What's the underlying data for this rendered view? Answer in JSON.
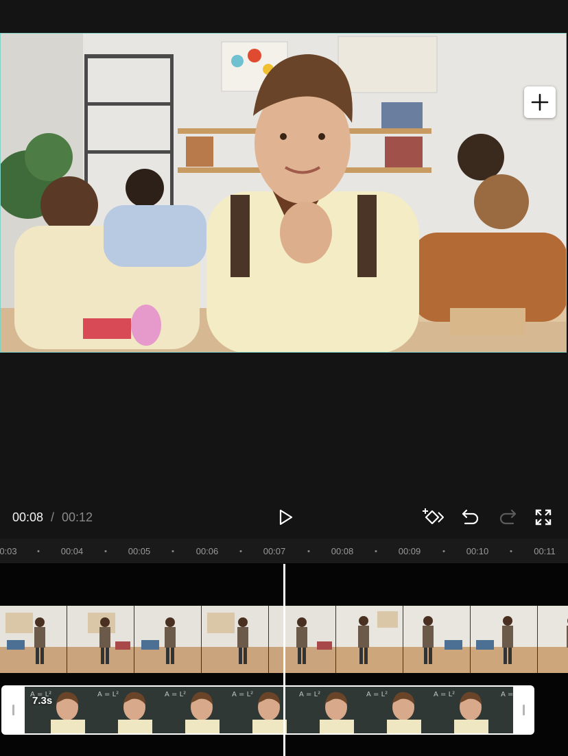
{
  "player": {
    "current_time": "00:08",
    "separator": "/",
    "total_time": "00:12"
  },
  "icons": {
    "play": "play-icon",
    "keyframe": "add-keyframe-icon",
    "undo": "undo-icon",
    "redo": "redo-icon",
    "fullscreen": "fullscreen-icon",
    "add": "plus-icon"
  },
  "ruler": {
    "labels": [
      "0:03",
      "00:04",
      "00:05",
      "00:06",
      "00:07",
      "00:08",
      "00:09",
      "00:10",
      "00:11"
    ]
  },
  "overlay_clip": {
    "duration": "7.3s"
  },
  "colors": {
    "background": "#141414",
    "selection_border": "#7fd3c6",
    "timeline_bg": "#050505"
  }
}
